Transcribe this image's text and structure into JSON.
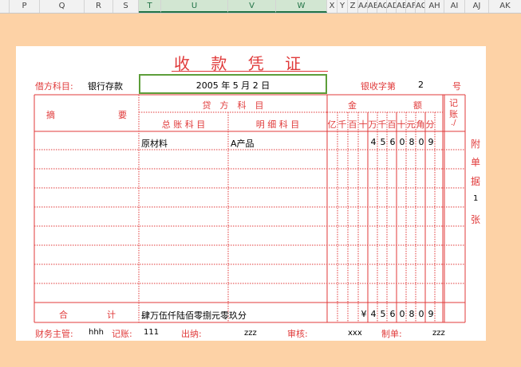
{
  "columns": [
    "P",
    "Q",
    "R",
    "S",
    "T",
    "U",
    "V",
    "W",
    "X",
    "Y",
    "Z",
    "AA",
    "AB",
    "AC",
    "AD",
    "AE",
    "AF",
    "AG",
    "AH",
    "AI",
    "AJ",
    "AK"
  ],
  "voucher": {
    "title": "收 款 凭 证",
    "debit_label": "借方科目:",
    "debit_value": "银行存款",
    "date": "2005 年 5 月 2 日",
    "voucher_no_label": "银收字第",
    "voucher_no_value": "2",
    "voucher_no_suffix": "号",
    "col_summary_1": "摘",
    "col_summary_2": "要",
    "col_credit": "贷　方　科　目",
    "col_general": "总 账 科 目",
    "col_detail": "明 细 科 目",
    "col_amount_1": "金",
    "col_amount_2": "额",
    "col_posted_1": "记",
    "col_posted_2": "账",
    "col_posted_3": "./",
    "units": [
      "亿",
      "千",
      "百",
      "十",
      "万",
      "千",
      "百",
      "十",
      "元",
      "角",
      "分"
    ],
    "row1_general": "原材料",
    "row1_detail": "A产品",
    "row1_digits": [
      "4",
      "5",
      "6",
      "0",
      "8",
      "0",
      "9"
    ],
    "attach": [
      "附",
      "单",
      "据",
      "1",
      "张"
    ],
    "total_label_1": "合",
    "total_label_2": "计",
    "total_words": "肆万伍仟陆佰零捌元零玖分",
    "total_digits": [
      "¥",
      "4",
      "5",
      "6",
      "0",
      "8",
      "0",
      "9"
    ],
    "footer": {
      "supervisor_label": "财务主管:",
      "supervisor_value": "hhh",
      "bookkeeper_label": "记账:",
      "bookkeeper_value": "111",
      "cashier_label": "出纳:",
      "cashier_value": "zzz",
      "auditor_label": "审核:",
      "auditor_value": "xxx",
      "preparer_label": "制单:",
      "preparer_value": "zzz"
    }
  }
}
